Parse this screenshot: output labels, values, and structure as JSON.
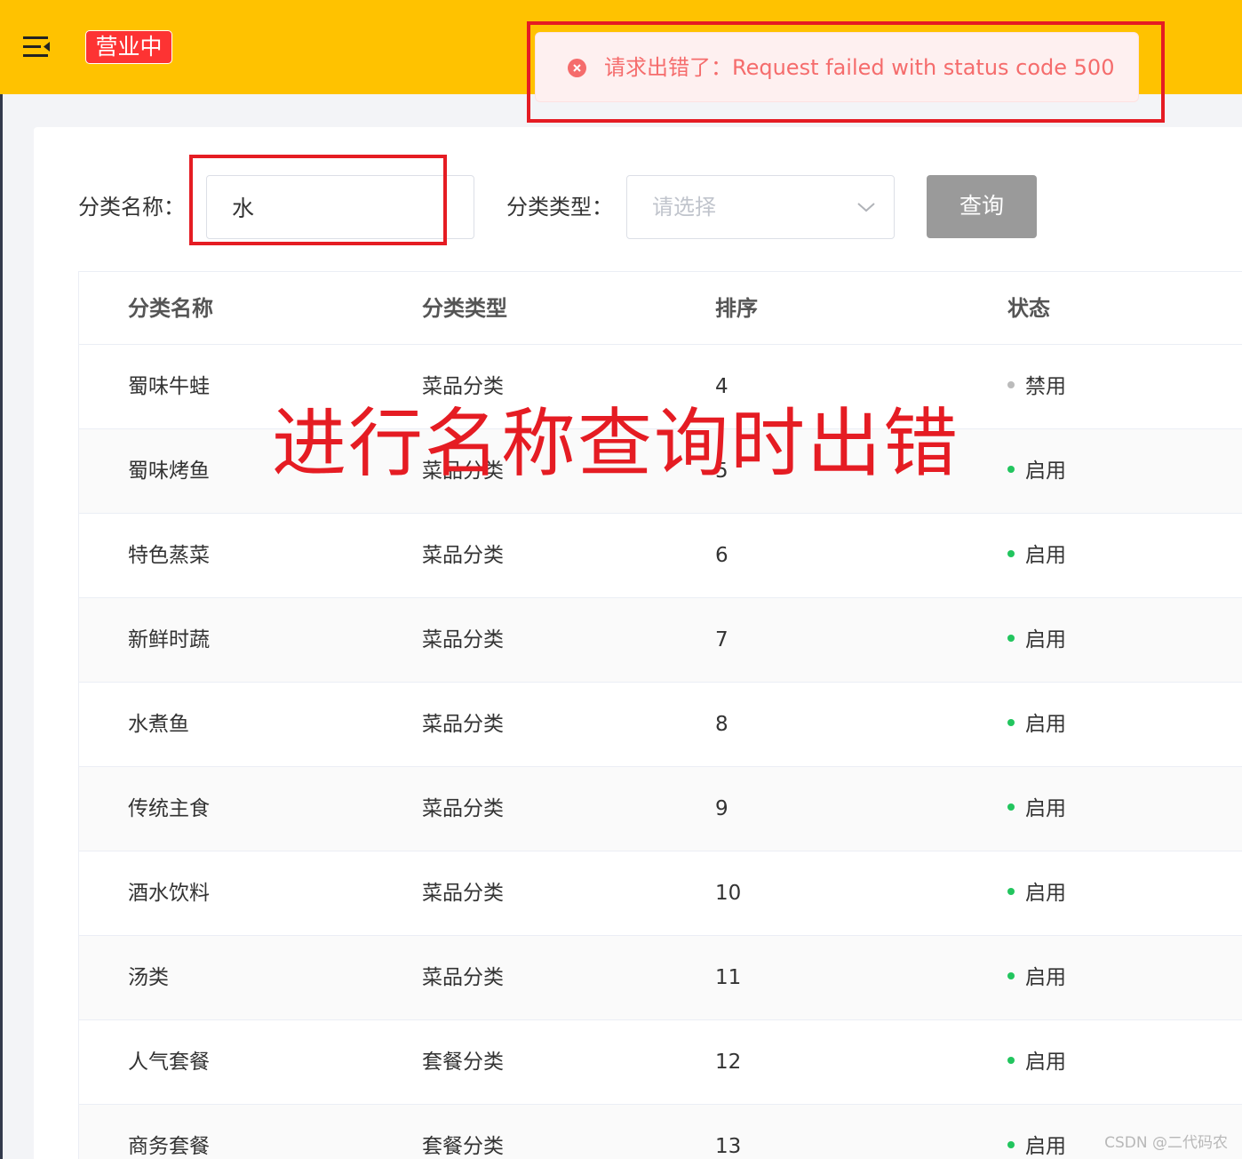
{
  "header": {
    "status_badge": "营业中",
    "accent_color": "#ffc200",
    "menu_icon": "menu-fold-icon"
  },
  "toast": {
    "type": "error",
    "icon": "error-circle-icon",
    "message": "请求出错了：Request failed with status code 500"
  },
  "filters": {
    "name_label": "分类名称：",
    "name_value": "水",
    "type_label": "分类类型：",
    "type_placeholder": "请选择",
    "query_button": "查询"
  },
  "table": {
    "columns": [
      "分类名称",
      "分类类型",
      "排序",
      "状态"
    ],
    "rows": [
      {
        "name": "蜀味牛蛙",
        "type": "菜品分类",
        "sort": "4",
        "status": "禁用",
        "status_color": "#bbbbbb"
      },
      {
        "name": "蜀味烤鱼",
        "type": "菜品分类",
        "sort": "5",
        "status": "启用",
        "status_color": "#22c55e"
      },
      {
        "name": "特色蒸菜",
        "type": "菜品分类",
        "sort": "6",
        "status": "启用",
        "status_color": "#22c55e"
      },
      {
        "name": "新鲜时蔬",
        "type": "菜品分类",
        "sort": "7",
        "status": "启用",
        "status_color": "#22c55e"
      },
      {
        "name": "水煮鱼",
        "type": "菜品分类",
        "sort": "8",
        "status": "启用",
        "status_color": "#22c55e"
      },
      {
        "name": "传统主食",
        "type": "菜品分类",
        "sort": "9",
        "status": "启用",
        "status_color": "#22c55e"
      },
      {
        "name": "酒水饮料",
        "type": "菜品分类",
        "sort": "10",
        "status": "启用",
        "status_color": "#22c55e"
      },
      {
        "name": "汤类",
        "type": "菜品分类",
        "sort": "11",
        "status": "启用",
        "status_color": "#22c55e"
      },
      {
        "name": "人气套餐",
        "type": "套餐分类",
        "sort": "12",
        "status": "启用",
        "status_color": "#22c55e"
      },
      {
        "name": "商务套餐",
        "type": "套餐分类",
        "sort": "13",
        "status": "启用",
        "status_color": "#22c55e"
      }
    ]
  },
  "annotation": {
    "text": "进行名称查询时出错",
    "color": "#e51c23"
  },
  "watermark": "CSDN @二代码农"
}
